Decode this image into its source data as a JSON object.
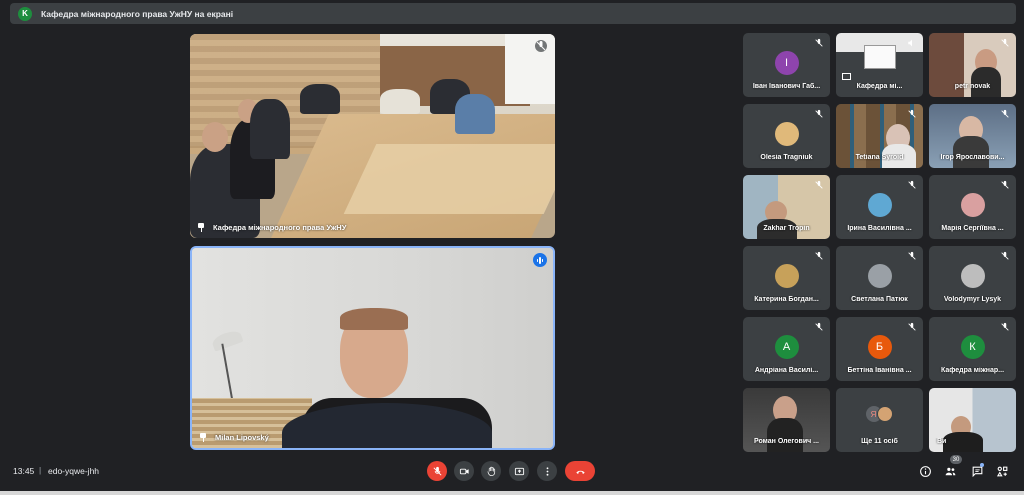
{
  "header": {
    "badge_letter": "K",
    "presenting_title": "Кафедра міжнародного права УжНУ на екрані"
  },
  "main_tiles": {
    "room_label": "Кафедра міжнародного права УжНУ",
    "speaker_label": "Milan Lipovský"
  },
  "participants": [
    {
      "name": "Іван Іванович Габ...",
      "avatar_letter": "І",
      "avatar_color": "#8e44ad",
      "type": "letter"
    },
    {
      "name": "Кафедра мі...",
      "type": "screen"
    },
    {
      "name": "petr novak",
      "type": "video",
      "bg": "#6d4b3d"
    },
    {
      "name": "Olesia Tragniuk",
      "type": "photo",
      "bg": "#e0b97a"
    },
    {
      "name": "Tetiana Syroid",
      "type": "video",
      "bg": "#7a6650"
    },
    {
      "name": "Ігор Ярославови...",
      "type": "video",
      "bg": "#7a8aa0"
    },
    {
      "name": "Zakhar Tropin",
      "type": "video",
      "bg": "#c9b89a"
    },
    {
      "name": "Ірина Василівна ...",
      "type": "photo",
      "bg": "#5fa8d3"
    },
    {
      "name": "Марія Сергіївна ...",
      "type": "photo",
      "bg": "#d9a0a0"
    },
    {
      "name": "Катерина Богдан...",
      "type": "photo",
      "bg": "#c7a15a"
    },
    {
      "name": "Светлана Патюк",
      "type": "photo",
      "bg": "#9aa0a6"
    },
    {
      "name": "Volodymyr Lysyk",
      "type": "photo",
      "bg": "#bdbdbd"
    },
    {
      "name": "Андріана Василі...",
      "avatar_letter": "А",
      "avatar_color": "#1e8e3e",
      "type": "letter"
    },
    {
      "name": "Беттіна Іванівна ...",
      "avatar_letter": "Б",
      "avatar_color": "#e8590c",
      "type": "letter"
    },
    {
      "name": "Кафедра міжнар...",
      "avatar_letter": "К",
      "avatar_color": "#1e8e3e",
      "type": "letter"
    },
    {
      "name": "Роман Олегович ...",
      "type": "video",
      "bg": "#4a4a4a"
    },
    {
      "name": "Ще 11 осіб",
      "type": "more",
      "more_letter": "Я"
    },
    {
      "name": "Ви",
      "type": "video",
      "bg": "#8d8d8d"
    }
  ],
  "bottom": {
    "time": "13:45",
    "separator": "|",
    "meeting_code": "edo-yqwe-jhh",
    "participant_count": "30"
  },
  "colors": {
    "background": "#202124",
    "tile": "#3c4043",
    "danger": "#ea4335",
    "accent": "#8ab4f8"
  },
  "icons": {
    "mic": "mic-off-icon",
    "camera": "camera-icon",
    "hand": "raise-hand-icon",
    "present": "present-icon",
    "more": "more-vert-icon",
    "end": "end-call-icon",
    "info": "info-icon",
    "people": "people-icon",
    "chat": "chat-icon",
    "activities": "activities-icon"
  }
}
